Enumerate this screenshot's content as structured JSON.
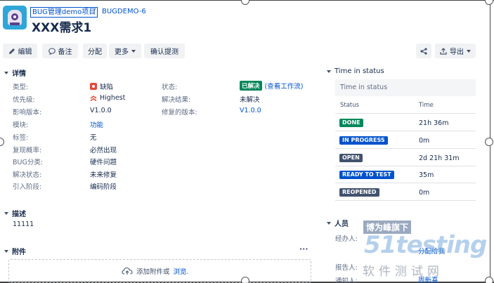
{
  "breadcrumb": {
    "project": "BUG管理demo项目",
    "separator": "/",
    "issue_key": "BUGDEMO-6"
  },
  "issue": {
    "title": "XXX需求1"
  },
  "toolbar": {
    "edit_label": "编辑",
    "comment_label": "备注",
    "assign_label": "分配",
    "more_label": "更多",
    "confirm_label": "确认提测",
    "export_label": "导出"
  },
  "details": {
    "heading": "详情",
    "left": [
      {
        "label": "类型:",
        "value": "缺陷",
        "icon": "bug-icon"
      },
      {
        "label": "优先级:",
        "value": "Highest",
        "icon": "priority-highest-icon"
      },
      {
        "label": "影响版本:",
        "value": "V1.0.0"
      },
      {
        "label": "模块:",
        "value": "功能",
        "link": true
      },
      {
        "label": "标签:",
        "value": "无"
      },
      {
        "label": "复现概率:",
        "value": "必然出现"
      },
      {
        "label": "BUG分类:",
        "value": "硬件问题"
      },
      {
        "label": "解决状态:",
        "value": "未来修复"
      },
      {
        "label": "引入阶段:",
        "value": "编码阶段"
      }
    ],
    "right": [
      {
        "label": "状态:",
        "value": "已解决",
        "extra": "(查看工作流)"
      },
      {
        "label": "解决结果:",
        "value": "未解决"
      },
      {
        "label": "修复的版本:",
        "value": "V1.0.0"
      }
    ]
  },
  "description": {
    "heading": "描述",
    "text": "11111"
  },
  "attachments": {
    "heading": "附件",
    "menu": "···",
    "add_text": "添加附件或",
    "browse": "浏览."
  },
  "time_in_status": {
    "heading": "Time in status",
    "box_label": "Time in status",
    "col_status": "Status",
    "col_time": "Time",
    "rows": [
      {
        "status": "DONE",
        "time": "21h 36m",
        "color": "#00875a"
      },
      {
        "status": "IN PROGRESS",
        "time": "0m",
        "color": "#0052cc"
      },
      {
        "status": "OPEN",
        "time": "2d 21h 31m",
        "color": "#42526e"
      },
      {
        "status": "READY TO TEST",
        "time": "35m",
        "color": "#0052cc"
      },
      {
        "status": "REOPENED",
        "time": "0m",
        "color": "#42526e"
      }
    ]
  },
  "people": {
    "heading": "人员",
    "assignee_label": "经办人:",
    "assign_to_me": "分配给我",
    "reporter_label": "报告人:",
    "watcher_label": "通知人:",
    "watcher_value": "周新喜"
  },
  "watermark": {
    "line1": "博为峰旗下",
    "line2": "51testing",
    "line3": "软件测试网"
  },
  "colors": {
    "link": "#0052cc",
    "done": "#00875a",
    "inprogress": "#0052cc",
    "open": "#42526e"
  }
}
